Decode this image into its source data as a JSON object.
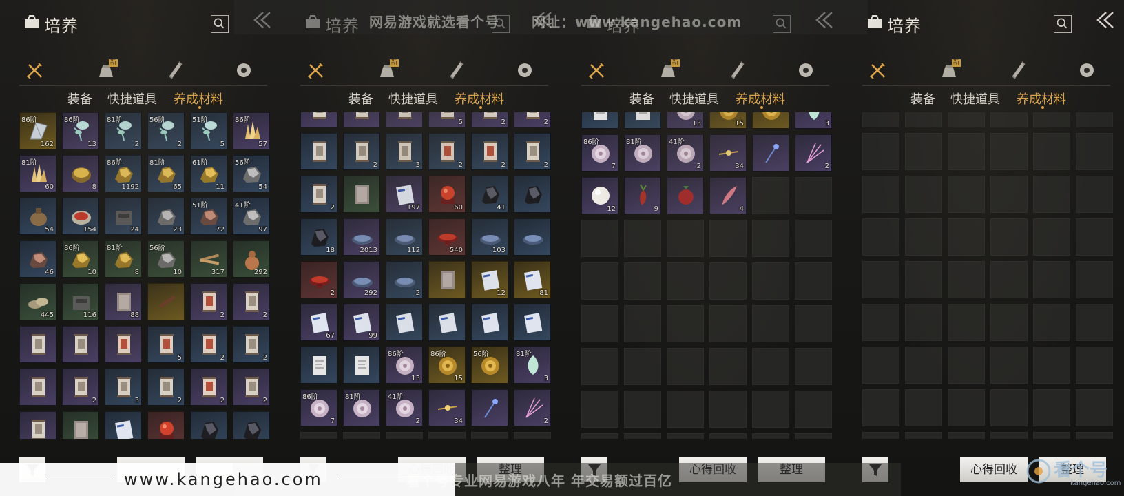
{
  "title": "培养",
  "tabs": [
    "装备",
    "快捷道具",
    "养成材料"
  ],
  "new_badge": "新",
  "buttons": {
    "recycle": "心得回收",
    "sort": "整理"
  },
  "icons": [
    "crossed-swords-icon",
    "pouch-icon",
    "scroll-icon",
    "token-icon"
  ],
  "colors": {
    "active_tab": "#e1a84c",
    "badge": "#d5a441"
  },
  "panels": [
    {
      "show_buttons": false,
      "cols": 6,
      "rows": 8,
      "offset": 0,
      "items": [
        {
          "q": "gold",
          "icon": "wing",
          "tier": "86阶",
          "count": "162"
        },
        {
          "q": "purple",
          "icon": "flower",
          "tier": "86阶",
          "count": "13"
        },
        {
          "q": "blue",
          "icon": "flower",
          "tier": "81阶",
          "count": "2"
        },
        {
          "q": "blue",
          "icon": "flower",
          "tier": "56阶",
          "count": "2"
        },
        {
          "q": "blue",
          "icon": "flower",
          "tier": "51阶",
          "count": "5"
        },
        {
          "q": "purple",
          "icon": "crystal",
          "tier": "86阶",
          "count": "57"
        },
        {
          "q": "purple",
          "icon": "crystal",
          "tier": "81阶",
          "count": "60"
        },
        {
          "q": "purple",
          "icon": "orb-gold",
          "tier": "",
          "count": "8"
        },
        {
          "q": "blue",
          "icon": "ore-gold",
          "tier": "86阶",
          "count": "1192"
        },
        {
          "q": "blue",
          "icon": "ore-gold",
          "tier": "81阶",
          "count": "65"
        },
        {
          "q": "blue",
          "icon": "ore-gold",
          "tier": "61阶",
          "count": "11"
        },
        {
          "q": "blue",
          "icon": "ore-grey",
          "tier": "56阶",
          "count": "54"
        },
        {
          "q": "blue",
          "icon": "pouch",
          "tier": "",
          "count": "54"
        },
        {
          "q": "blue",
          "icon": "box-red",
          "tier": "",
          "count": "154"
        },
        {
          "q": "blue",
          "icon": "chest",
          "tier": "",
          "count": "24"
        },
        {
          "q": "blue",
          "icon": "ore-grey",
          "tier": "",
          "count": "23"
        },
        {
          "q": "blue",
          "icon": "ore-red",
          "tier": "51阶",
          "count": "72"
        },
        {
          "q": "blue",
          "icon": "ore-grey",
          "tier": "41阶",
          "count": "97"
        },
        {
          "q": "blue",
          "icon": "ore-red",
          "tier": "",
          "count": "46"
        },
        {
          "q": "green",
          "icon": "ore-gold",
          "tier": "86阶",
          "count": "10"
        },
        {
          "q": "green",
          "icon": "ore-gold",
          "tier": "81阶",
          "count": "8"
        },
        {
          "q": "green",
          "icon": "ore-grey",
          "tier": "56阶",
          "count": "10"
        },
        {
          "q": "green",
          "icon": "wood",
          "tier": "",
          "count": "317"
        },
        {
          "q": "green",
          "icon": "gourd",
          "tier": "",
          "count": "292"
        },
        {
          "q": "green",
          "icon": "stones",
          "tier": "",
          "count": "445"
        },
        {
          "q": "green",
          "icon": "chest",
          "tier": "",
          "count": "116"
        },
        {
          "q": "purple",
          "icon": "book",
          "tier": "",
          "count": "88"
        },
        {
          "q": "gold",
          "icon": "stick",
          "tier": "",
          "count": ""
        },
        {
          "q": "purple",
          "icon": "scroll-red",
          "tier": "",
          "count": "2"
        },
        {
          "q": "purple",
          "icon": "scroll",
          "tier": "",
          "count": "2"
        },
        {
          "q": "purple",
          "icon": "scroll",
          "tier": "",
          "count": ""
        },
        {
          "q": "purple",
          "icon": "scroll",
          "tier": "",
          "count": ""
        },
        {
          "q": "purple",
          "icon": "scroll-red",
          "tier": "",
          "count": ""
        },
        {
          "q": "blue",
          "icon": "scroll-red",
          "tier": "",
          "count": "5"
        },
        {
          "q": "blue",
          "icon": "scroll-red",
          "tier": "",
          "count": "2"
        },
        {
          "q": "blue",
          "icon": "scroll",
          "tier": "",
          "count": "2"
        },
        {
          "q": "purple",
          "icon": "scroll",
          "tier": "",
          "count": ""
        },
        {
          "q": "purple",
          "icon": "scroll",
          "tier": "",
          "count": "2"
        },
        {
          "q": "blue",
          "icon": "scroll",
          "tier": "",
          "count": "3"
        },
        {
          "q": "blue",
          "icon": "scroll",
          "tier": "",
          "count": "2"
        },
        {
          "q": "purple",
          "icon": "scroll-red",
          "tier": "",
          "count": "2"
        },
        {
          "q": "purple",
          "icon": "scroll",
          "tier": "",
          "count": "2"
        },
        {
          "q": "purple",
          "icon": "scroll",
          "tier": "",
          "count": ""
        },
        {
          "q": "green",
          "icon": "book",
          "tier": "",
          "count": ""
        },
        {
          "q": "blue",
          "icon": "manual",
          "tier": "",
          "count": ""
        },
        {
          "q": "red",
          "icon": "orb-red",
          "tier": "",
          "count": ""
        },
        {
          "q": "blue",
          "icon": "ore-dark",
          "tier": "",
          "count": ""
        },
        {
          "q": "blue",
          "icon": "ore-dark",
          "tier": "",
          "count": ""
        }
      ]
    },
    {
      "show_buttons": true,
      "cols": 6,
      "rows": 8,
      "offset": -32,
      "items": [
        {
          "q": "purple",
          "icon": "scroll",
          "tier": "",
          "count": ""
        },
        {
          "q": "purple",
          "icon": "scroll",
          "tier": "",
          "count": ""
        },
        {
          "q": "purple",
          "icon": "scroll",
          "tier": "",
          "count": ""
        },
        {
          "q": "purple",
          "icon": "scroll",
          "tier": "",
          "count": "5"
        },
        {
          "q": "purple",
          "icon": "scroll",
          "tier": "",
          "count": "2"
        },
        {
          "q": "purple",
          "icon": "scroll",
          "tier": "",
          "count": "2"
        },
        {
          "q": "blue",
          "icon": "scroll",
          "tier": "",
          "count": ""
        },
        {
          "q": "blue",
          "icon": "scroll",
          "tier": "",
          "count": "2"
        },
        {
          "q": "blue",
          "icon": "scroll",
          "tier": "",
          "count": "3"
        },
        {
          "q": "blue",
          "icon": "scroll-red",
          "tier": "",
          "count": "2"
        },
        {
          "q": "blue",
          "icon": "scroll-red",
          "tier": "",
          "count": "2"
        },
        {
          "q": "blue",
          "icon": "scroll",
          "tier": "",
          "count": "2"
        },
        {
          "q": "blue",
          "icon": "scroll",
          "tier": "",
          "count": "2"
        },
        {
          "q": "green",
          "icon": "book",
          "tier": "",
          "count": ""
        },
        {
          "q": "purple",
          "icon": "manual",
          "tier": "",
          "count": "197"
        },
        {
          "q": "red",
          "icon": "orb-red",
          "tier": "",
          "count": "60"
        },
        {
          "q": "blue",
          "icon": "ore-dark",
          "tier": "",
          "count": "41"
        },
        {
          "q": "blue",
          "icon": "ore-dark",
          "tier": "",
          "count": ""
        },
        {
          "q": "blue",
          "icon": "ore-dark",
          "tier": "",
          "count": "18"
        },
        {
          "q": "purple",
          "icon": "dish",
          "tier": "",
          "count": "2013"
        },
        {
          "q": "blue",
          "icon": "dish",
          "tier": "",
          "count": "112"
        },
        {
          "q": "red",
          "icon": "dish-red",
          "tier": "",
          "count": "540"
        },
        {
          "q": "blue",
          "icon": "dish",
          "tier": "",
          "count": "103"
        },
        {
          "q": "blue",
          "icon": "dish",
          "tier": "",
          "count": ""
        },
        {
          "q": "red",
          "icon": "dish-red",
          "tier": "",
          "count": "2"
        },
        {
          "q": "purple",
          "icon": "dish",
          "tier": "",
          "count": "292"
        },
        {
          "q": "blue",
          "icon": "dish",
          "tier": "",
          "count": "2"
        },
        {
          "q": "gold",
          "icon": "book",
          "tier": "",
          "count": ""
        },
        {
          "q": "gold",
          "icon": "manual",
          "tier": "",
          "count": "12"
        },
        {
          "q": "gold",
          "icon": "manual",
          "tier": "",
          "count": "81"
        },
        {
          "q": "purple",
          "icon": "manual",
          "tier": "",
          "count": "67"
        },
        {
          "q": "purple",
          "icon": "manual",
          "tier": "",
          "count": "99"
        },
        {
          "q": "blue",
          "icon": "manual",
          "tier": "",
          "count": ""
        },
        {
          "q": "blue",
          "icon": "manual",
          "tier": "",
          "count": ""
        },
        {
          "q": "blue",
          "icon": "manual",
          "tier": "",
          "count": ""
        },
        {
          "q": "blue",
          "icon": "manual",
          "tier": "",
          "count": ""
        },
        {
          "q": "blue",
          "icon": "letter",
          "tier": "",
          "count": ""
        },
        {
          "q": "blue",
          "icon": "letter",
          "tier": "",
          "count": ""
        },
        {
          "q": "purple",
          "icon": "shell",
          "tier": "86阶",
          "count": "13"
        },
        {
          "q": "gold",
          "icon": "shell-gold",
          "tier": "86阶",
          "count": "15"
        },
        {
          "q": "gold",
          "icon": "shell-gold",
          "tier": "56阶",
          "count": ""
        },
        {
          "q": "purple",
          "icon": "bud",
          "tier": "81阶",
          "count": "3"
        },
        {
          "q": "purple",
          "icon": "shell",
          "tier": "86阶",
          "count": "7"
        },
        {
          "q": "purple",
          "icon": "shell",
          "tier": "81阶",
          "count": ""
        },
        {
          "q": "purple",
          "icon": "shell",
          "tier": "41阶",
          "count": "2"
        },
        {
          "q": "purple",
          "icon": "sparkle",
          "tier": "",
          "count": "34"
        },
        {
          "q": "purple",
          "icon": "wand",
          "tier": "",
          "count": ""
        },
        {
          "q": "purple",
          "icon": "firework",
          "tier": "",
          "count": "2"
        }
      ]
    },
    {
      "show_buttons": true,
      "cols": 6,
      "rows": 8,
      "offset": -30,
      "items": [
        {
          "q": "blue",
          "icon": "letter",
          "tier": "",
          "count": ""
        },
        {
          "q": "blue",
          "icon": "letter",
          "tier": "",
          "count": ""
        },
        {
          "q": "purple",
          "icon": "shell",
          "tier": "",
          "count": "13"
        },
        {
          "q": "gold",
          "icon": "shell-gold",
          "tier": "",
          "count": "15"
        },
        {
          "q": "gold",
          "icon": "shell-gold",
          "tier": "",
          "count": ""
        },
        {
          "q": "purple",
          "icon": "bud",
          "tier": "",
          "count": "3"
        },
        {
          "q": "purple",
          "icon": "shell",
          "tier": "86阶",
          "count": "7"
        },
        {
          "q": "purple",
          "icon": "shell",
          "tier": "81阶",
          "count": ""
        },
        {
          "q": "purple",
          "icon": "shell",
          "tier": "41阶",
          "count": "2"
        },
        {
          "q": "purple",
          "icon": "sparkle",
          "tier": "",
          "count": "34"
        },
        {
          "q": "purple",
          "icon": "wand",
          "tier": "",
          "count": ""
        },
        {
          "q": "purple",
          "icon": "firework",
          "tier": "",
          "count": "2"
        },
        {
          "q": "purple",
          "icon": "pearl",
          "tier": "",
          "count": "12"
        },
        {
          "q": "purple",
          "icon": "radish",
          "tier": "",
          "count": "9"
        },
        {
          "q": "purple",
          "icon": "berry",
          "tier": "",
          "count": ""
        },
        {
          "q": "purple",
          "icon": "feather",
          "tier": "",
          "count": "4"
        }
      ]
    },
    {
      "show_buttons": true,
      "cols": 6,
      "rows": 8,
      "offset": -32,
      "items": []
    }
  ],
  "watermark": {
    "top_text_a": "网易游戏就选看个号",
    "top_text_b": "网址：www.kangehao.com",
    "bottom_url": "www.kangehao.com",
    "bottom_slogan": "看个号专业网易游戏八年  年交易额过百亿",
    "logo_text": "看个号",
    "logo_sub": "kangehao.com"
  }
}
